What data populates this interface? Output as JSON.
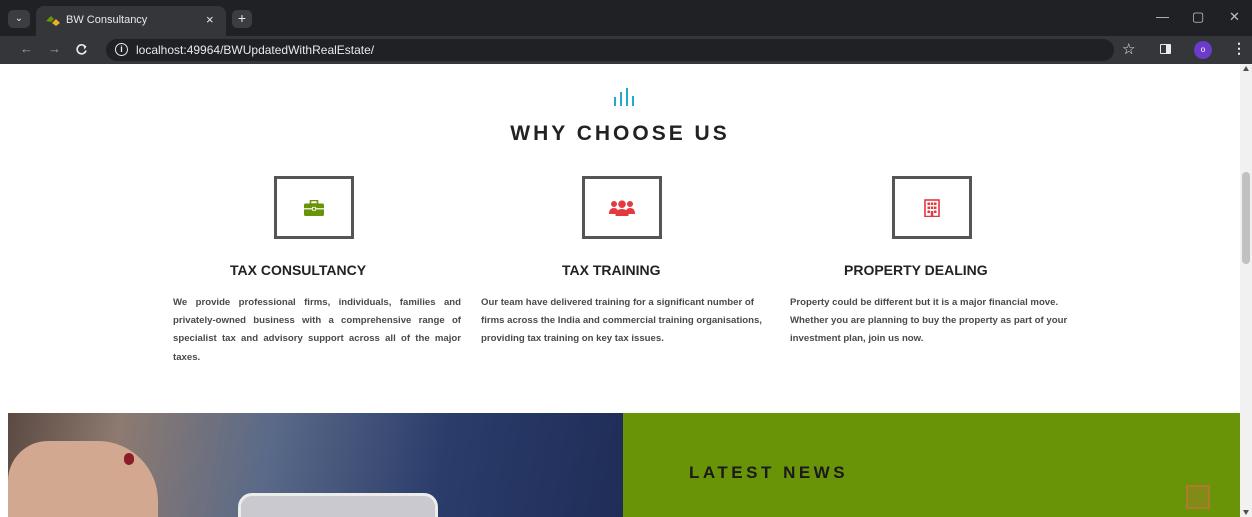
{
  "browser": {
    "tab_title": "BW Consultancy",
    "tab_close": "×",
    "new_tab": "+",
    "tab_menu": "⌄",
    "url": "localhost:49964/BWUpdatedWithRealEstate/",
    "profile_initial": "o",
    "win_minimize": "—",
    "win_restore": "▢",
    "win_close": "✕"
  },
  "why_choose_us": {
    "title": "WHY CHOOSE US",
    "accent_color": "#23a9c9",
    "features": [
      {
        "title": "TAX CONSULTANCY",
        "icon": "briefcase-icon",
        "icon_color": "#6a9408",
        "text": "We provide professional firms, individuals, families and privately-owned business with a comprehensive range of specialist tax and advisory support across all of the major taxes."
      },
      {
        "title": "TAX TRAINING",
        "icon": "users-icon",
        "icon_color": "#e53940",
        "text": "Our team have delivered training for a significant number of firms across the India and commercial training organisations, providing tax training on key tax issues."
      },
      {
        "title": "PROPERTY DEALING",
        "icon": "building-icon",
        "icon_color": "#e53940",
        "text": "Property could be different but it is a major financial move. Whether you are planning to buy the property as part of your investment plan, join us now."
      }
    ]
  },
  "latest_news": {
    "title": "LATEST NEWS",
    "panel_color": "#6a9408"
  }
}
